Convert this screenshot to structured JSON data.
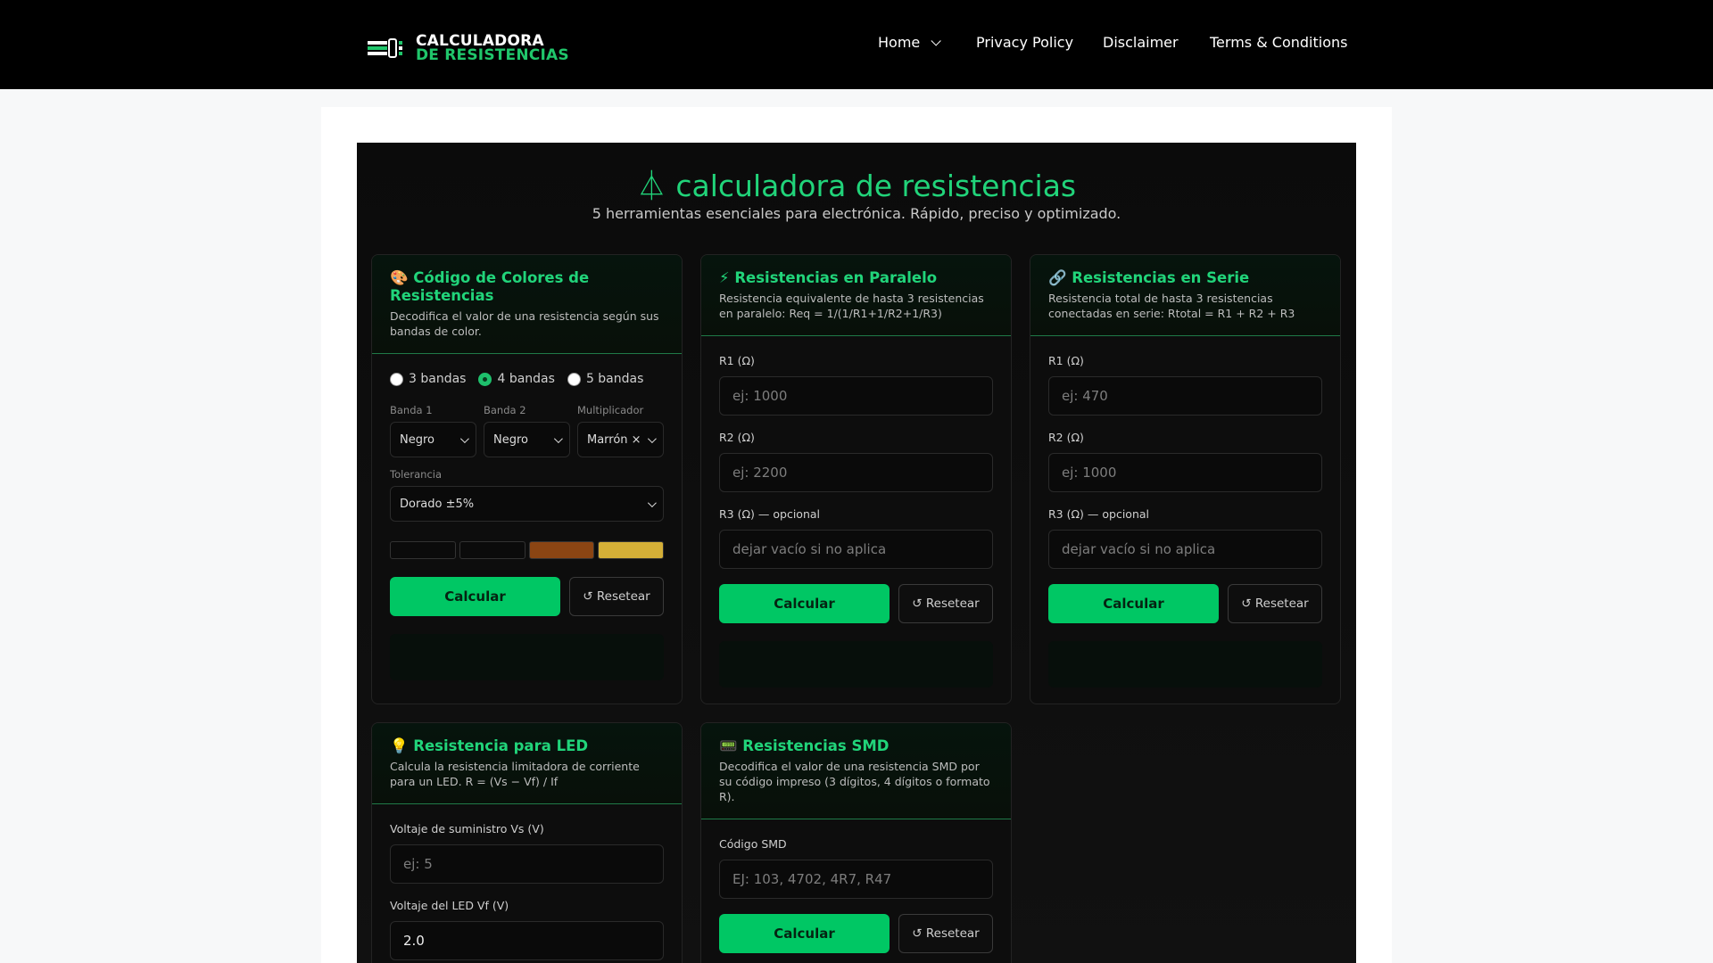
{
  "header": {
    "logo_line1": "CALCULADORA",
    "logo_line2": "DE RESISTENCIAS",
    "nav": {
      "home": "Home",
      "privacy": "Privacy Policy",
      "disclaimer": "Disclaimer",
      "terms": "Terms & Conditions"
    }
  },
  "app": {
    "title": "⏃ calculadora de resistencias",
    "subtitle": "5 herramientas esenciales para electrónica. Rápido, preciso y optimizado."
  },
  "common": {
    "calc_label": "Calcular",
    "reset_label": "↺ Resetear"
  },
  "colores": {
    "title": "🎨 Código de Colores de Resistencias",
    "desc": "Decodifica el valor de una resistencia según sus bandas de color.",
    "radios": [
      "3 bandas",
      "4 bandas",
      "5 bandas"
    ],
    "selected_radio": "4 bandas",
    "band1_label": "Banda 1",
    "band1_value": "Negro",
    "band2_label": "Banda 2",
    "band2_value": "Negro",
    "mult_label": "Multiplicador",
    "mult_value": "Marrón ×",
    "tol_label": "Tolerancia",
    "tol_value": "Dorado ±5%",
    "swatch_colors": [
      "#0b0b0b",
      "#0b0b0b",
      "#8b4513",
      "#d4af37"
    ]
  },
  "paralelo": {
    "title": "⚡ Resistencias en Paralelo",
    "desc": "Resistencia equivalente de hasta 3 resistencias en paralelo: Req = 1/(1/R1+1/R2+1/R3)",
    "r1_label": "R1 (Ω)",
    "r1_placeholder": "ej: 1000",
    "r2_label": "R2 (Ω)",
    "r2_placeholder": "ej: 2200",
    "r3_label": "R3 (Ω) — opcional",
    "r3_placeholder": "dejar vacío si no aplica"
  },
  "serie": {
    "title": "🔗 Resistencias en Serie",
    "desc": "Resistencia total de hasta 3 resistencias conectadas en serie: Rtotal = R1 + R2 + R3",
    "r1_label": "R1 (Ω)",
    "r1_placeholder": "ej: 470",
    "r2_label": "R2 (Ω)",
    "r2_placeholder": "ej: 1000",
    "r3_label": "R3 (Ω) — opcional",
    "r3_placeholder": "dejar vacío si no aplica"
  },
  "led": {
    "title": "💡 Resistencia para LED",
    "desc": "Calcula la resistencia limitadora de corriente para un LED. R = (Vs − Vf) / If",
    "vs_label": "Voltaje de suministro Vs (V)",
    "vs_placeholder": "ej: 5",
    "vf_label": "Voltaje del LED Vf (V)",
    "vf_value": "2.0"
  },
  "smd": {
    "title": "📟 Resistencias SMD",
    "desc": "Decodifica el valor de una resistencia SMD por su código impreso (3 dígitos, 4 dígitos o formato R).",
    "code_label": "Código SMD",
    "code_placeholder": "EJ: 103, 4702, 4R7, R47"
  }
}
